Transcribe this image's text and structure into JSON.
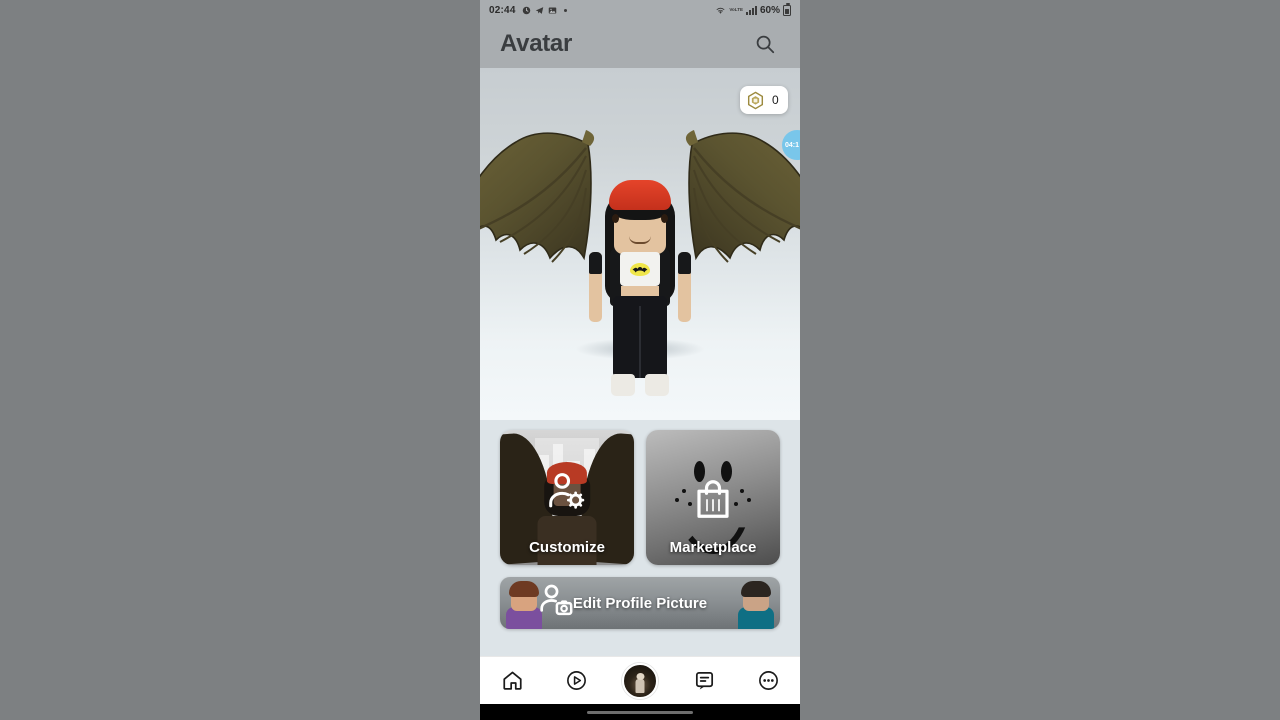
{
  "status_bar": {
    "time": "02:44",
    "battery_percent": "60%",
    "network_label": "VoLTE",
    "icons": [
      "clock-icon",
      "telegram-icon",
      "gallery-icon",
      "dot-indicator",
      "wifi-icon",
      "signal-icon",
      "battery-icon"
    ]
  },
  "header": {
    "title": "Avatar",
    "search_icon": "search-icon"
  },
  "avatar_stage": {
    "robux": {
      "icon": "robux-icon",
      "amount": "0"
    },
    "edge_bubble": {
      "label": "04:1"
    },
    "character": {
      "hat": "red beanie",
      "hair": "long black hair",
      "accessory": "bat wings",
      "shirt": "batman logo crop top",
      "pants": "black pants",
      "shoes": "white sneakers"
    }
  },
  "cards": [
    {
      "id": "customize",
      "label": "Customize",
      "icon": "person-gear-icon"
    },
    {
      "id": "marketplace",
      "label": "Marketplace",
      "icon": "shopping-bag-icon"
    }
  ],
  "edit_profile": {
    "label": "Edit Profile Picture",
    "icon": "person-camera-icon"
  },
  "bottom_nav": {
    "items": [
      {
        "id": "home",
        "icon": "home-icon",
        "selected": false
      },
      {
        "id": "discover",
        "icon": "play-circle-icon",
        "selected": false
      },
      {
        "id": "avatar",
        "icon": "avatar-thumbnail",
        "selected": true
      },
      {
        "id": "chat",
        "icon": "chat-icon",
        "selected": false
      },
      {
        "id": "more",
        "icon": "ellipsis-circle-icon",
        "selected": false
      }
    ]
  },
  "colors": {
    "page_bg": "#dde4e8",
    "header_bg": "#a9adb0",
    "letterbox": "#7d8082",
    "accent_red": "#c4301c",
    "robux_gold": "#9c8a3e"
  }
}
